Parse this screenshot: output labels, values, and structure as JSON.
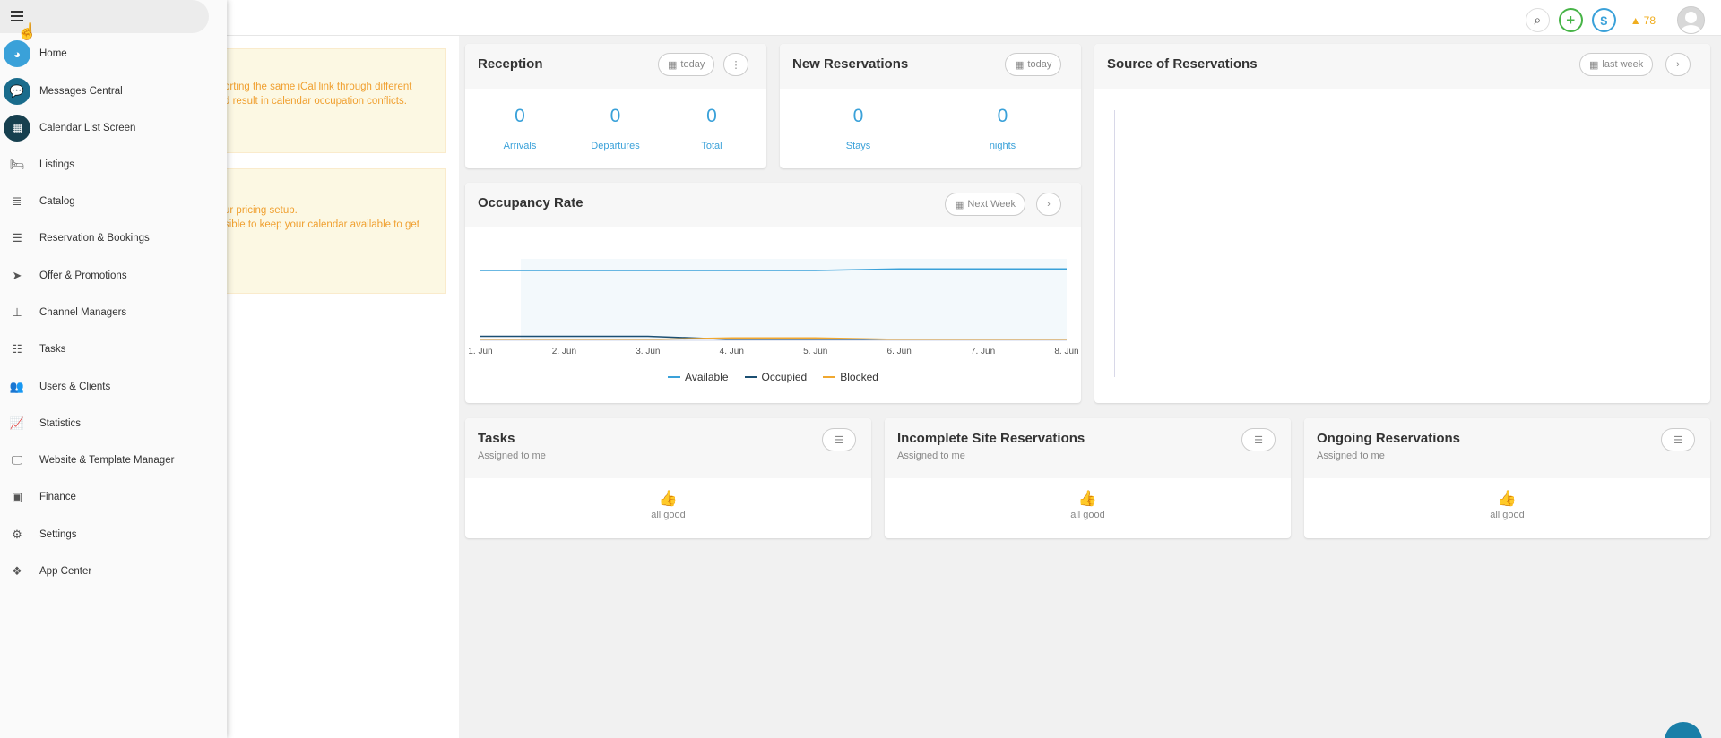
{
  "topbar": {
    "alert_count": "78"
  },
  "notices": [
    {
      "line1": "orting the same iCal link through different",
      "line2": "d result in calendar occupation conflicts."
    },
    {
      "line1": "ur pricing setup.",
      "line2": "sible to keep your calendar available to get"
    }
  ],
  "sidebar": {
    "items": [
      {
        "label": "Home",
        "icon": "dashboard-icon",
        "glyph": "◕"
      },
      {
        "label": "Messages Central",
        "icon": "chat-icon",
        "glyph": "💬"
      },
      {
        "label": "Calendar List Screen",
        "icon": "calendar-icon",
        "glyph": "▦"
      },
      {
        "label": "Listings",
        "icon": "bed-icon",
        "glyph": "🛏"
      },
      {
        "label": "Catalog",
        "icon": "database-icon",
        "glyph": "≣"
      },
      {
        "label": "Reservation & Bookings",
        "icon": "list-icon",
        "glyph": "☰"
      },
      {
        "label": "Offer & Promotions",
        "icon": "paper-plane-icon",
        "glyph": "➤"
      },
      {
        "label": "Channel Managers",
        "icon": "sitemap-icon",
        "glyph": "⊥"
      },
      {
        "label": "Tasks",
        "icon": "tasks-icon",
        "glyph": "☷"
      },
      {
        "label": "Users & Clients",
        "icon": "users-icon",
        "glyph": "👥"
      },
      {
        "label": "Statistics",
        "icon": "line-chart-icon",
        "glyph": "📈"
      },
      {
        "label": "Website & Template Manager",
        "icon": "desktop-icon",
        "glyph": "🖵"
      },
      {
        "label": "Finance",
        "icon": "money-icon",
        "glyph": "▣"
      },
      {
        "label": "Settings",
        "icon": "gear-icon",
        "glyph": "⚙"
      },
      {
        "label": "App Center",
        "icon": "cubes-icon",
        "glyph": "❖"
      }
    ]
  },
  "reception": {
    "title": "Reception",
    "filter_label": "today",
    "stats": [
      {
        "value": "0",
        "label": "Arrivals"
      },
      {
        "value": "0",
        "label": "Departures"
      },
      {
        "value": "0",
        "label": "Total"
      }
    ]
  },
  "new_reservations": {
    "title": "New Reservations",
    "filter_label": "today",
    "stats": [
      {
        "value": "0",
        "label": "Stays"
      },
      {
        "value": "0",
        "label": "nights"
      }
    ]
  },
  "source_reservations": {
    "title": "Source of Reservations",
    "filter_label": "last week"
  },
  "occupancy": {
    "title": "Occupancy Rate",
    "filter_label": "Next Week"
  },
  "tasks": {
    "title": "Tasks",
    "subtitle": "Assigned to me",
    "empty_text": "all good"
  },
  "incomplete": {
    "title": "Incomplete Site Reservations",
    "subtitle": "Assigned to me",
    "empty_text": "all good"
  },
  "ongoing": {
    "title": "Ongoing Reservations",
    "subtitle": "Assigned to me",
    "empty_text": "all good"
  },
  "colors": {
    "accent": "#3aa1d9",
    "available": "#3aa1d9",
    "occupied": "#1b4f72",
    "blocked": "#f0a830",
    "sidebar_badge_home": "#3aa1d9",
    "sidebar_badge_messages": "#1a6c8c",
    "sidebar_badge_calendar": "#17404f"
  },
  "chart_data": {
    "type": "line",
    "title": "",
    "xlabel": "",
    "ylabel": "",
    "x": [
      "1. Jun",
      "2. Jun",
      "3. Jun",
      "4. Jun",
      "5. Jun",
      "6. Jun",
      "7. Jun",
      "8. Jun"
    ],
    "ylim": [
      0,
      3
    ],
    "grid": false,
    "legend": "bottom",
    "series": [
      {
        "name": "Available",
        "values": [
          2.2,
          2.2,
          2.2,
          2.2,
          2.2,
          2.25,
          2.25,
          2.25
        ]
      },
      {
        "name": "Occupied",
        "values": [
          0.1,
          0.1,
          0.1,
          0.0,
          0.0,
          0.0,
          0.0,
          0.0
        ]
      },
      {
        "name": "Blocked",
        "values": [
          0.0,
          0.0,
          0.0,
          0.05,
          0.05,
          0.0,
          0.0,
          0.0
        ]
      }
    ]
  }
}
